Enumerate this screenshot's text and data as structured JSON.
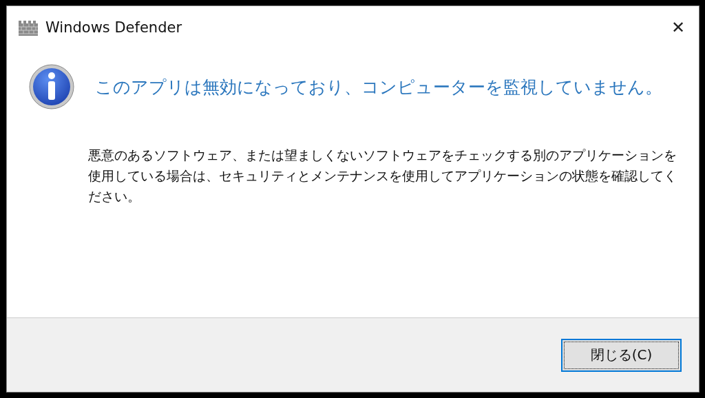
{
  "window": {
    "title": "Windows Defender",
    "close": "✕"
  },
  "message": {
    "heading": "このアプリは無効になっており、コンピューターを監視していません。",
    "body": "悪意のあるソフトウェア、または望ましくないソフトウェアをチェックする別のアプリケーションを使用している場合は、セキュリティとメンテナンスを使用してアプリケーションの状態を確認してください。"
  },
  "buttons": [
    {
      "label": "閉じる(C)",
      "selected": true
    }
  ]
}
